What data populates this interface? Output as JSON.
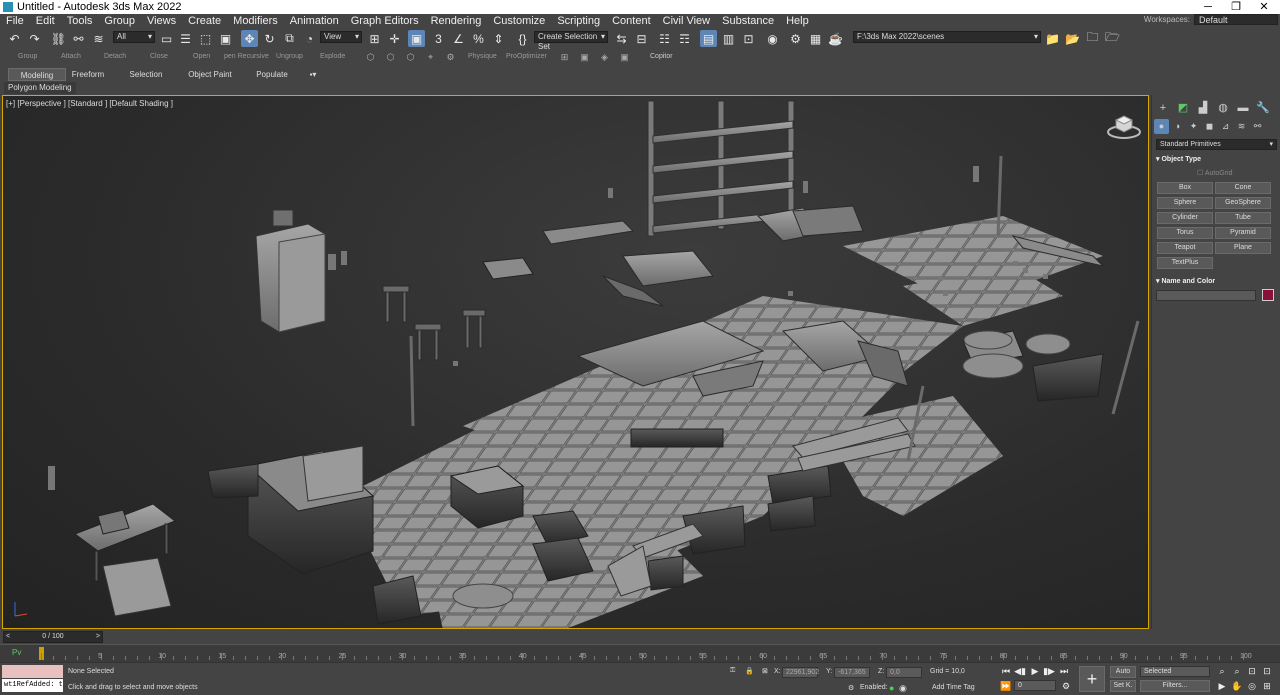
{
  "window": {
    "title": "Untitled - Autodesk 3ds Max 2022"
  },
  "menu": [
    "File",
    "Edit",
    "Tools",
    "Group",
    "Views",
    "Create",
    "Modifiers",
    "Animation",
    "Graph Editors",
    "Rendering",
    "Customize",
    "Scripting",
    "Content",
    "Civil View",
    "Substance",
    "Help"
  ],
  "workspace": {
    "label": "Workspaces:",
    "value": "Default"
  },
  "toolbar": {
    "filter": "All",
    "ref_coord": "View",
    "selection_set": "Create Selection Set",
    "path": "F:\\3ds Max 2022\\scenes"
  },
  "toolbar2": [
    "Group",
    "Attach",
    "Detach",
    "Close",
    "Open",
    "pen Recursive",
    "Ungroup",
    "Explode",
    "Physique",
    "ProOptimizer",
    "Copitor"
  ],
  "ribbon": {
    "tabs": [
      "Modeling",
      "Freeform",
      "Selection",
      "Object Paint",
      "Populate"
    ],
    "active": "Modeling",
    "panel": "Polygon Modeling"
  },
  "viewport": {
    "label": "[+] [Perspective ] [Standard ] [Default Shading ]"
  },
  "command_panel": {
    "dropdown": "Standard Primitives",
    "object_type": "Object Type",
    "autogrid": "AutoGrid",
    "buttons": [
      "Box",
      "Cone",
      "Sphere",
      "GeoSphere",
      "Cylinder",
      "Tube",
      "Torus",
      "Pyramid",
      "Teapot",
      "Plane",
      "TextPlus"
    ],
    "name_color": "Name and Color",
    "color": "#8a0f3a"
  },
  "timeline": {
    "slider": "0 / 100",
    "ticks": [
      "5",
      "10",
      "15",
      "20",
      "25",
      "30",
      "35",
      "40",
      "45",
      "50",
      "55",
      "60",
      "65",
      "70",
      "75",
      "80",
      "85",
      "90",
      "95",
      "100"
    ]
  },
  "status": {
    "script_text": "wt1RefAdded: t",
    "selection": "None Selected",
    "prompt": "Click and drag to select and move objects",
    "x_label": "X:",
    "x_value": "22961,902",
    "y_label": "Y:",
    "y_value": "-617,365",
    "z_label": "Z:",
    "z_value": "0,0",
    "grid": "Grid = 10,0",
    "enabled": "Enabled:",
    "add_time_tag": "Add Time Tag",
    "auto": "Auto",
    "set_key": "Set K.",
    "selected": "Selected",
    "filters": "Filters...",
    "frame": "0"
  }
}
